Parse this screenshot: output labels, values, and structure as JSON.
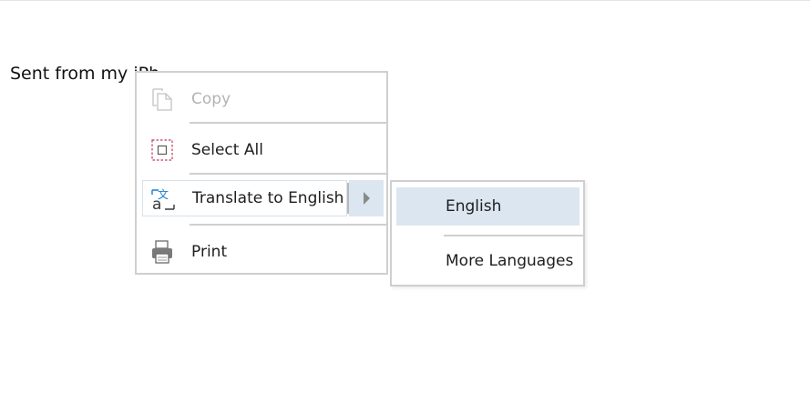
{
  "document": {
    "body_text": "Sent from my iPh"
  },
  "context_menu": {
    "items": [
      {
        "label": "Copy",
        "icon": "copy-icon",
        "enabled": false
      },
      {
        "label": "Select All",
        "icon": "select-all-icon",
        "enabled": true
      },
      {
        "label": "Translate to English",
        "icon": "translate-icon",
        "enabled": true,
        "has_submenu": true
      },
      {
        "label": "Print",
        "icon": "printer-icon",
        "enabled": true
      }
    ]
  },
  "submenu": {
    "items": [
      {
        "label": "English",
        "highlighted": true
      },
      {
        "label": "More Languages",
        "highlighted": false
      }
    ]
  },
  "colors": {
    "highlight": "#dce6f0",
    "border": "#cfcfcf",
    "disabled_text": "#b3b3b3",
    "select_icon": "#c8365a",
    "translate_icon_accent": "#1a7bd1"
  }
}
